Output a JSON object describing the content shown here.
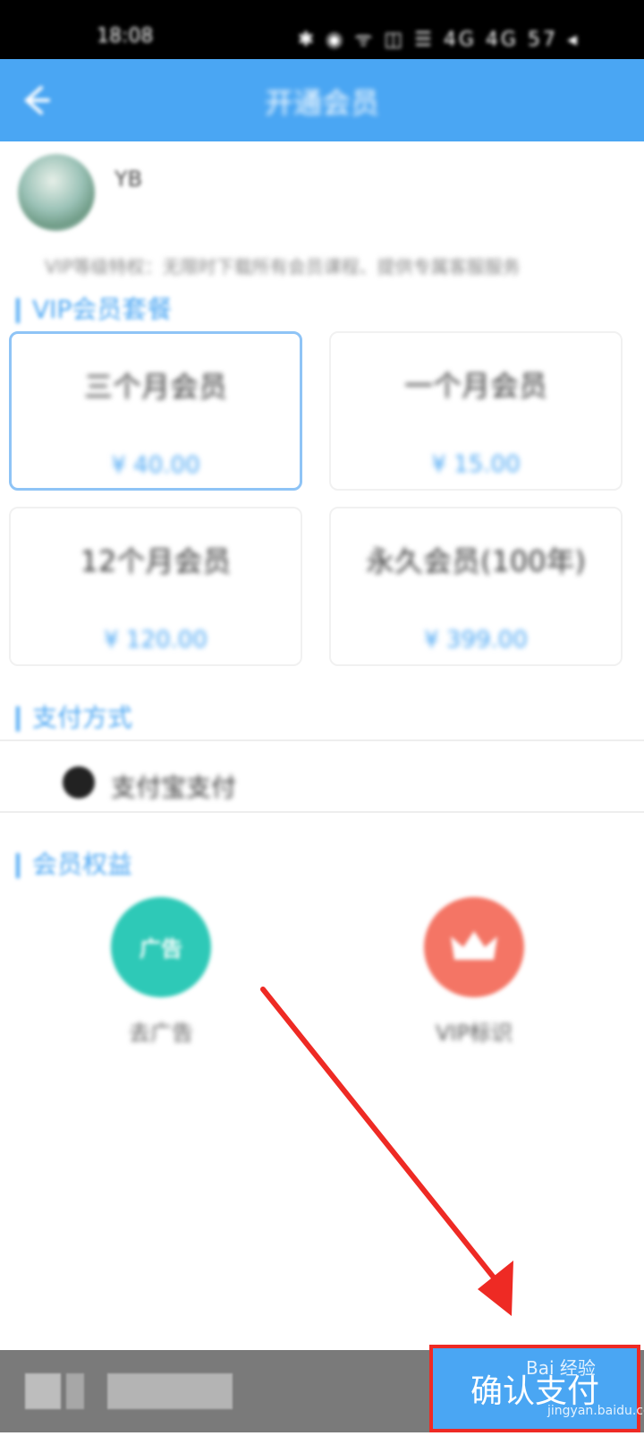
{
  "status_bar": {
    "time": "18:08",
    "icons": "✱ ◉ ᯤ ◫ ☰ 4G 4G 57 ◂"
  },
  "title_bar": {
    "back_icon": "back-arrow-icon",
    "title": "开通会员"
  },
  "profile": {
    "username": "YB"
  },
  "vip_description": "VIP等级特权：无限时下载所有会员课程、提供专属客服服务",
  "sections": {
    "plans_title": "VIP会员套餐",
    "payment_title": "支付方式",
    "benefits_title": "会员权益"
  },
  "plans": [
    {
      "name": "三个月会员",
      "price": "¥ 40.00",
      "selected": true
    },
    {
      "name": "一个月会员",
      "price": "¥ 15.00",
      "selected": false
    },
    {
      "name": "12个月会员",
      "price": "¥ 120.00",
      "selected": false
    },
    {
      "name": "永久会员(100年)",
      "price": "¥ 399.00",
      "selected": false
    }
  ],
  "payment": {
    "method_label": "支付宝支付",
    "selected": true
  },
  "benefits": [
    {
      "label": "去广告",
      "icon": "ad-free-icon",
      "badge": "广告",
      "color": "#2ec9b7"
    },
    {
      "label": "VIP标识",
      "icon": "crown-icon",
      "color": "#f47565"
    }
  ],
  "bottom_bar": {
    "confirm_label": "确认支付"
  },
  "watermark": {
    "text": "Bai 经验",
    "sub": "jingyan.baidu.com"
  },
  "colors": {
    "primary": "#4aa6f3",
    "highlight": "#ee2a24"
  }
}
